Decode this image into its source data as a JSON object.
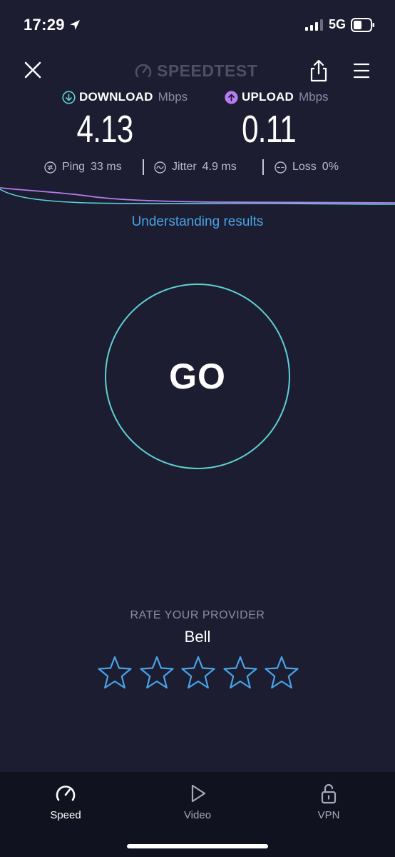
{
  "status_bar": {
    "time": "17:29",
    "network": "5G"
  },
  "header": {
    "title": "SPEEDTEST"
  },
  "results": {
    "download": {
      "label": "DOWNLOAD",
      "unit": "Mbps",
      "value": "4.13",
      "color": "#5ed1d6"
    },
    "upload": {
      "label": "UPLOAD",
      "unit": "Mbps",
      "value": "0.11",
      "color": "#b67cf0"
    },
    "ping": {
      "label": "Ping",
      "value": "33 ms"
    },
    "jitter": {
      "label": "Jitter",
      "value": "4.9 ms"
    },
    "loss": {
      "label": "Loss",
      "value": "0%"
    }
  },
  "understanding_link": "Understanding results",
  "go_button": {
    "label": "GO",
    "ring_color": "#5ed1d6"
  },
  "rating": {
    "title": "RATE YOUR PROVIDER",
    "provider": "Bell",
    "stars_total": 5,
    "stars_filled": 0,
    "star_color": "#4aa3e8"
  },
  "tab_bar": {
    "tabs": [
      {
        "label": "Speed",
        "icon": "speedometer-icon",
        "active": true
      },
      {
        "label": "Video",
        "icon": "play-icon",
        "active": false
      },
      {
        "label": "VPN",
        "icon": "lock-icon",
        "active": false
      }
    ]
  },
  "colors": {
    "background": "#1c1d31",
    "tab_bar": "#111220",
    "link": "#4aa3e8"
  }
}
